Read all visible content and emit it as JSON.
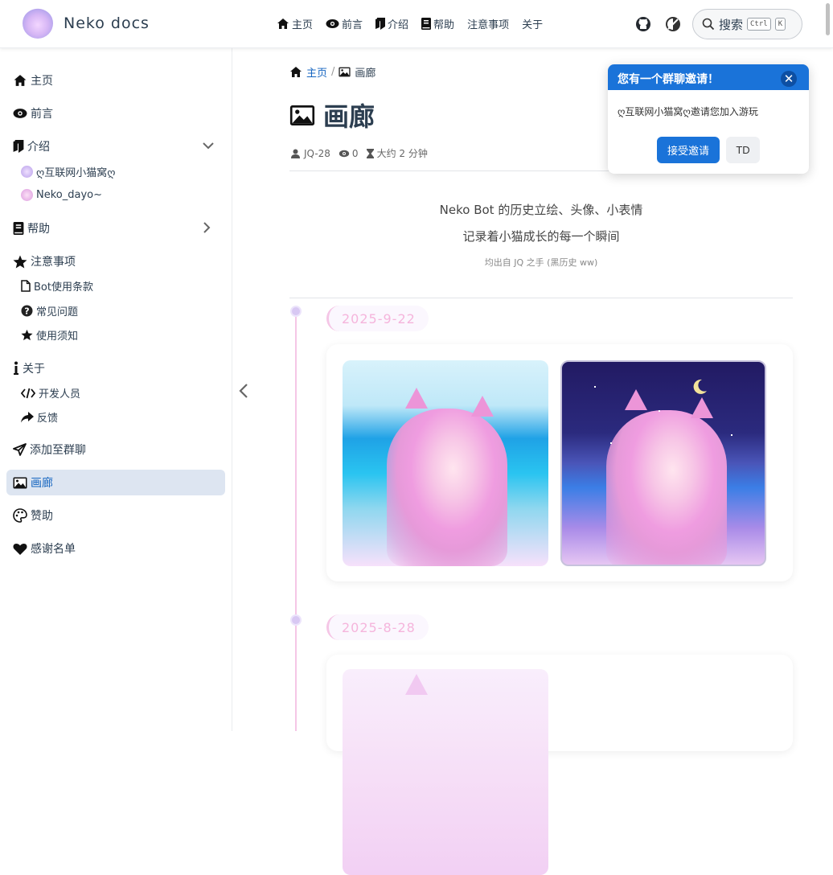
{
  "header": {
    "site_name": "Neko docs",
    "nav": [
      {
        "icon": "home-icon",
        "label": "主页"
      },
      {
        "icon": "eye-icon",
        "label": "前言"
      },
      {
        "icon": "book-open-icon",
        "label": "介绍"
      },
      {
        "icon": "book-icon",
        "label": "帮助"
      },
      {
        "label": "注意事项"
      },
      {
        "label": "关于"
      }
    ],
    "search_label": "搜索",
    "search_keys": [
      "Ctrl",
      "K"
    ]
  },
  "sidebar": {
    "items": [
      {
        "icon": "home-icon",
        "label": "主页"
      },
      {
        "icon": "eye-icon",
        "label": "前言"
      },
      {
        "icon": "book-open-icon",
        "label": "介绍",
        "expanded": true
      },
      {
        "icon": "avatar-icon",
        "label": "ღ互联网小猫窝ღ",
        "sub": true
      },
      {
        "icon": "avatar-icon",
        "label": "Neko_dayo~",
        "sub": true
      },
      {
        "icon": "book-icon",
        "label": "帮助",
        "expanded": false
      },
      {
        "icon": "star-icon",
        "label": "注意事项"
      },
      {
        "icon": "file-icon",
        "label": "Bot使用条款",
        "sub": true
      },
      {
        "icon": "question-icon",
        "label": "常见问题",
        "sub": true
      },
      {
        "icon": "star-icon",
        "label": "使用须知",
        "sub": true
      },
      {
        "icon": "info-icon",
        "label": "关于"
      },
      {
        "icon": "code-icon",
        "label": "开发人员",
        "sub": true
      },
      {
        "icon": "share-icon",
        "label": "反馈",
        "sub": true
      },
      {
        "icon": "send-icon",
        "label": "添加至群聊"
      },
      {
        "icon": "image-icon",
        "label": "画廊",
        "active": true
      },
      {
        "icon": "palette-icon",
        "label": "赞助"
      },
      {
        "icon": "heart-icon",
        "label": "感谢名单"
      }
    ]
  },
  "breadcrumb": {
    "home": "主页",
    "separator": "/",
    "current": "画廊"
  },
  "page": {
    "title": "画廊",
    "author": "JQ-28",
    "views": "0",
    "read_time": "大约 2 分钟",
    "desc_line1": "Neko Bot 的历史立绘、头像、小表情",
    "desc_line2": "记录着小猫成长的每一个瞬间",
    "desc_note": "均出自 JQ 之手 (黑历史 ww)"
  },
  "timeline": [
    {
      "date": "2025-9-22",
      "images": 2
    },
    {
      "date": "2025-8-28",
      "images": 1
    }
  ],
  "popup": {
    "title": "您有一个群聊邀请！",
    "message": "ღ互联网小猫窝ღ邀请您加入游玩",
    "accept_label": "接受邀请",
    "td_label": "TD"
  },
  "colors": {
    "accent": "#1a73d9",
    "active_bg": "#dde5f1",
    "timeline_pink": "#f5c6e6",
    "date_text": "#f5b5dc"
  }
}
